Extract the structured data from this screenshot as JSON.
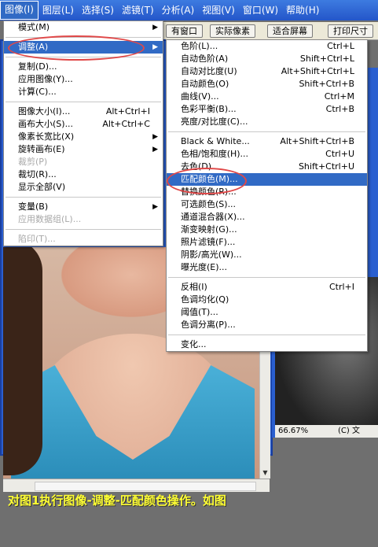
{
  "menubar": {
    "items": [
      "图像(I)",
      "图层(L)",
      "选择(S)",
      "滤镜(T)",
      "分析(A)",
      "视图(V)",
      "窗口(W)",
      "帮助(H)"
    ]
  },
  "options_bar": {
    "buttons": [
      "有窗口",
      "实际像素",
      "适合屏幕",
      "打印尺寸"
    ]
  },
  "image_menu": [
    {
      "label": "模式(M)",
      "arrow": true
    },
    {
      "sep": true
    },
    {
      "label": "调整(A)",
      "arrow": true,
      "highlighted": true
    },
    {
      "sep": true
    },
    {
      "label": "复制(D)..."
    },
    {
      "label": "应用图像(Y)..."
    },
    {
      "label": "计算(C)..."
    },
    {
      "sep": true
    },
    {
      "label": "图像大小(I)...",
      "shortcut": "Alt+Ctrl+I"
    },
    {
      "label": "画布大小(S)...",
      "shortcut": "Alt+Ctrl+C"
    },
    {
      "label": "像素长宽比(X)",
      "arrow": true
    },
    {
      "label": "旋转画布(E)",
      "arrow": true
    },
    {
      "label": "裁剪(P)",
      "disabled": true
    },
    {
      "label": "裁切(R)..."
    },
    {
      "label": "显示全部(V)"
    },
    {
      "sep": true
    },
    {
      "label": "变量(B)",
      "arrow": true
    },
    {
      "label": "应用数据组(L)...",
      "disabled": true
    },
    {
      "sep": true
    },
    {
      "label": "陷印(T)...",
      "disabled": true
    }
  ],
  "adjust_menu": [
    {
      "label": "色阶(L)...",
      "shortcut": "Ctrl+L"
    },
    {
      "label": "自动色阶(A)",
      "shortcut": "Shift+Ctrl+L"
    },
    {
      "label": "自动对比度(U)",
      "shortcut": "Alt+Shift+Ctrl+L"
    },
    {
      "label": "自动颜色(O)",
      "shortcut": "Shift+Ctrl+B"
    },
    {
      "label": "曲线(V)...",
      "shortcut": "Ctrl+M"
    },
    {
      "label": "色彩平衡(B)...",
      "shortcut": "Ctrl+B"
    },
    {
      "label": "亮度/对比度(C)..."
    },
    {
      "sep": true
    },
    {
      "label": "Black & White...",
      "shortcut": "Alt+Shift+Ctrl+B"
    },
    {
      "label": "色相/饱和度(H)...",
      "shortcut": "Ctrl+U"
    },
    {
      "label": "去色(D)",
      "shortcut": "Shift+Ctrl+U"
    },
    {
      "label": "匹配颜色(M)...",
      "highlighted": true
    },
    {
      "label": "替换颜色(R)..."
    },
    {
      "label": "可选颜色(S)..."
    },
    {
      "label": "通道混合器(X)..."
    },
    {
      "label": "渐变映射(G)..."
    },
    {
      "label": "照片滤镜(F)..."
    },
    {
      "label": "阴影/高光(W)..."
    },
    {
      "label": "曝光度(E)..."
    },
    {
      "sep": true
    },
    {
      "label": "反相(I)",
      "shortcut": "Ctrl+I"
    },
    {
      "label": "色调均化(Q)"
    },
    {
      "label": "阈值(T)..."
    },
    {
      "label": "色调分离(P)..."
    },
    {
      "sep": true
    },
    {
      "label": "变化..."
    }
  ],
  "right_window": {
    "zoom": "66.67%",
    "status_text": "(C) 文"
  },
  "caption": "对图1执行图像-调整-匹配颜色操作。如图",
  "colors": {
    "highlight": "#316ac5",
    "annotation": "#e04848",
    "caption": "#ffff33"
  }
}
